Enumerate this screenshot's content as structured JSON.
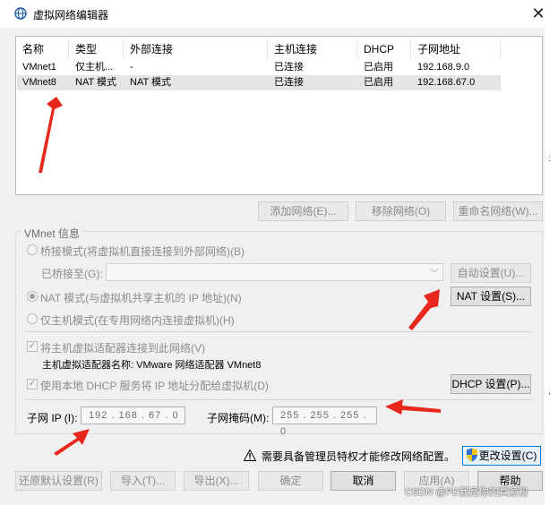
{
  "window": {
    "title": "虚拟网络编辑器",
    "close": "✕"
  },
  "table": {
    "headers": [
      "名称",
      "类型",
      "外部连接",
      "主机连接",
      "DHCP",
      "子网地址"
    ],
    "rows": [
      [
        "VMnet1",
        "仅主机...",
        "-",
        "已连接",
        "已启用",
        "192.168.9.0"
      ],
      [
        "VMnet8",
        "NAT 模式",
        "NAT 模式",
        "已连接",
        "已启用",
        "192.168.67.0"
      ]
    ],
    "selected_row": 1
  },
  "table_buttons": {
    "add": "添加网络(E)...",
    "remove": "移除网络(O)",
    "rename": "重命名网络(W)..."
  },
  "vmnet_info": {
    "group_title": "VMnet 信息",
    "bridge_radio": "桥接模式(将虚拟机直接连接到外部网络)(B)",
    "bridged_to_label": "已桥接至(G):",
    "auto_settings": "自动设置(U)...",
    "nat_radio": "NAT 模式(与虚拟机共享主机的 IP 地址)(N)",
    "nat_settings": "NAT 设置(S)...",
    "host_only_radio": "仅主机模式(在专用网络内连接虚拟机)(H)",
    "connect_adapter_check": "将主机虚拟适配器连接到此网络(V)",
    "adapter_name": "主机虚拟适配器名称: VMware 网络适配器 VMnet8",
    "dhcp_check": "使用本地 DHCP 服务将 IP 地址分配给虚拟机(D)",
    "dhcp_settings": "DHCP 设置(P)...",
    "subnet_ip_label": "子网 IP (I):",
    "subnet_ip_value": "192 . 168 . 67 . 0",
    "subnet_mask_label": "子网掩码(M):",
    "subnet_mask_value": "255 . 255 . 255 . 0"
  },
  "admin": {
    "notice": "需要具备管理员特权才能修改网络配置。",
    "change_settings": "更改设置(C)"
  },
  "footer_buttons": {
    "restore": "还原默认设置(R)",
    "import": "导入(T)...",
    "export": "导出(X)...",
    "ok": "确定",
    "cancel": "取消",
    "apply": "应用(A)",
    "help": "帮助"
  },
  "watermark": "CSDN @PD我是你的真爱粉",
  "colors": {
    "annotation_arrow": "#e8281c",
    "selected_row": "#e5e5e5",
    "focus_border": "#0078d7"
  }
}
